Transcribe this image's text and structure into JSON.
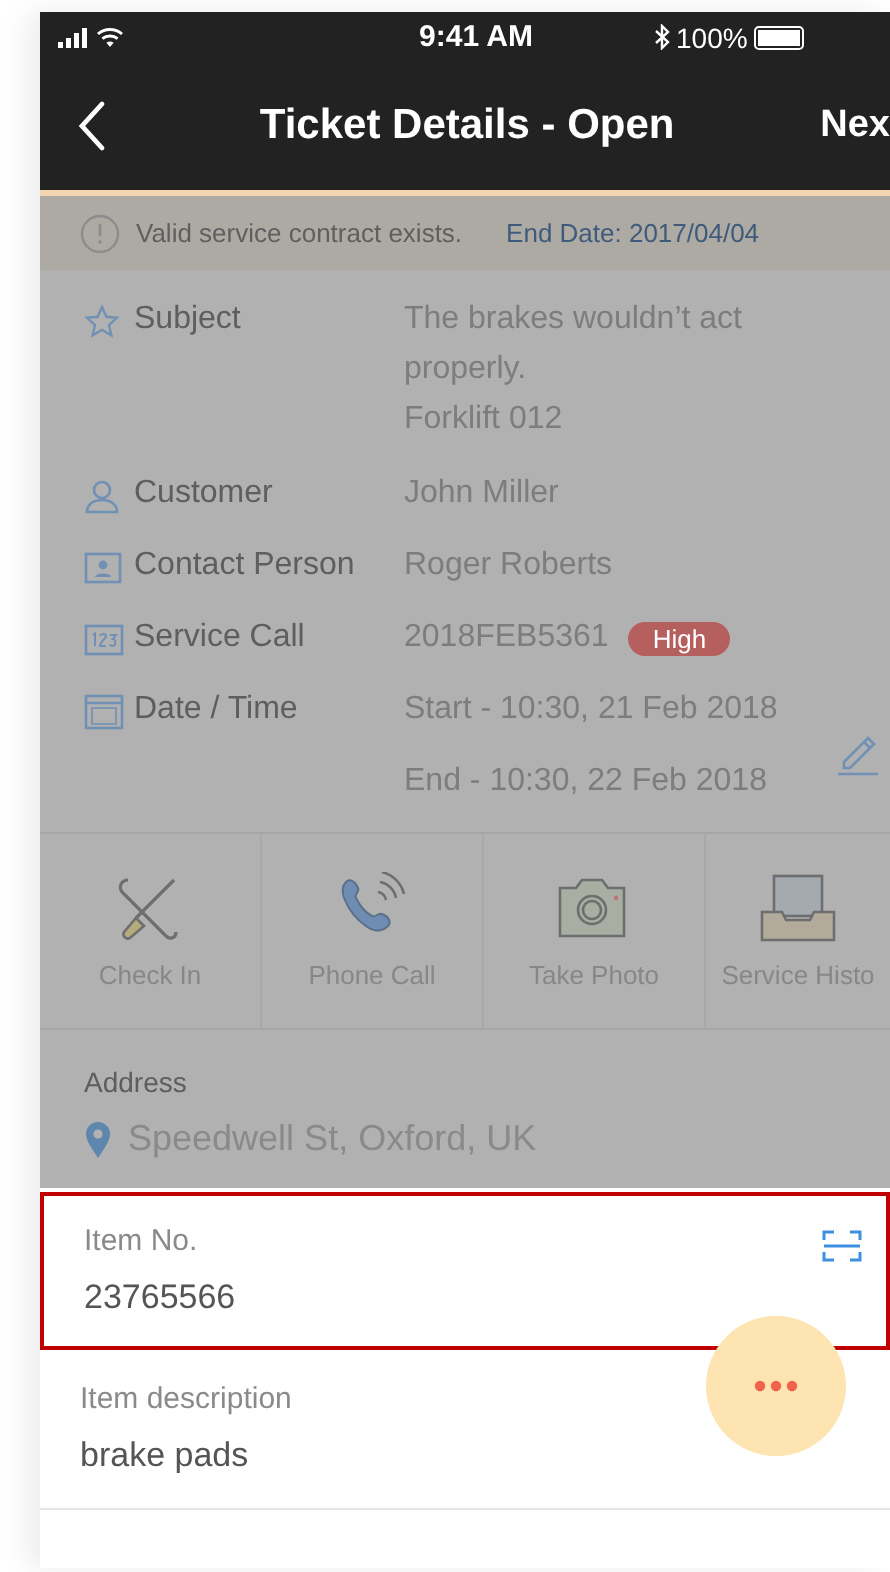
{
  "status_bar": {
    "time": "9:41 AM",
    "battery": "100%"
  },
  "nav": {
    "title": "Ticket Details - Open",
    "next": "Nex"
  },
  "banner": {
    "message": "Valid service contract exists.",
    "end_date": "End Date: 2017/04/04"
  },
  "details": [
    {
      "kind": "subject",
      "label": "Subject",
      "lines": [
        "The brakes wouldn’t act properly.",
        "Forklift 012"
      ]
    },
    {
      "kind": "customer",
      "label": "Customer",
      "lines": [
        "John Miller"
      ]
    },
    {
      "kind": "contact",
      "label": "Contact Person",
      "lines": [
        "Roger Roberts"
      ]
    },
    {
      "kind": "service_call",
      "label": "Service Call",
      "lines": [
        "2018FEB5361"
      ],
      "badge": "High"
    },
    {
      "kind": "date",
      "label": "Date / Time",
      "lines": [
        "Start - 10:30, 21 Feb 2018",
        "End - 10:30, 22 Feb 2018"
      ]
    }
  ],
  "actions": [
    {
      "kind": "check_in",
      "label": "Check In"
    },
    {
      "kind": "phone",
      "label": "Phone Call"
    },
    {
      "kind": "photo",
      "label": "Take Photo"
    },
    {
      "kind": "history",
      "label": "Service Histo"
    }
  ],
  "address": {
    "label": "Address",
    "value": "Speedwell St, Oxford, UK"
  },
  "fields": [
    {
      "kind": "scan",
      "label": "Item No.",
      "value": "23765566",
      "highlighted": true
    },
    {
      "kind": "text",
      "label": "Item description",
      "value": "brake pads",
      "highlighted": false
    }
  ]
}
